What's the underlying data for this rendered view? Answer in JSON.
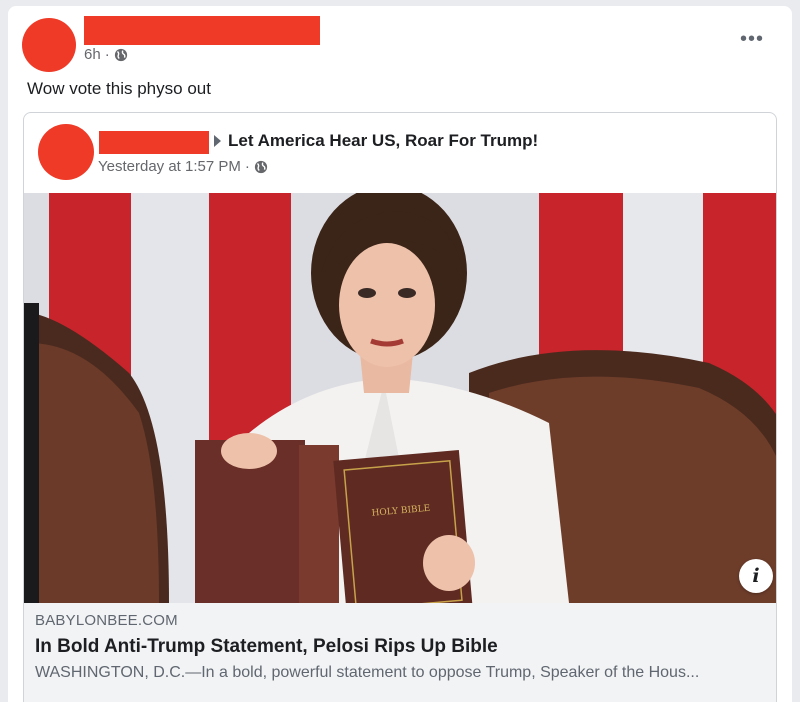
{
  "post": {
    "time": "6h",
    "separator": "·",
    "text": "Wow vote this physo out",
    "more_icon": "more-options-icon"
  },
  "shared_post": {
    "group_name": "Let America Hear US, Roar For Trump!",
    "time": "Yesterday at 1:57 PM",
    "separator": "·"
  },
  "link": {
    "domain": "BABYLONBEE.COM",
    "headline": "In Bold Anti-Trump Statement, Pelosi Rips Up Bible",
    "description": "WASHINGTON, D.C.—In a bold, powerful statement to oppose Trump, Speaker of the Hous...",
    "book_text": "HOLY BIBLE"
  },
  "colors": {
    "redaction": "#ee3a27",
    "secondary_text": "#65676b",
    "link_bg": "#f2f3f5"
  }
}
